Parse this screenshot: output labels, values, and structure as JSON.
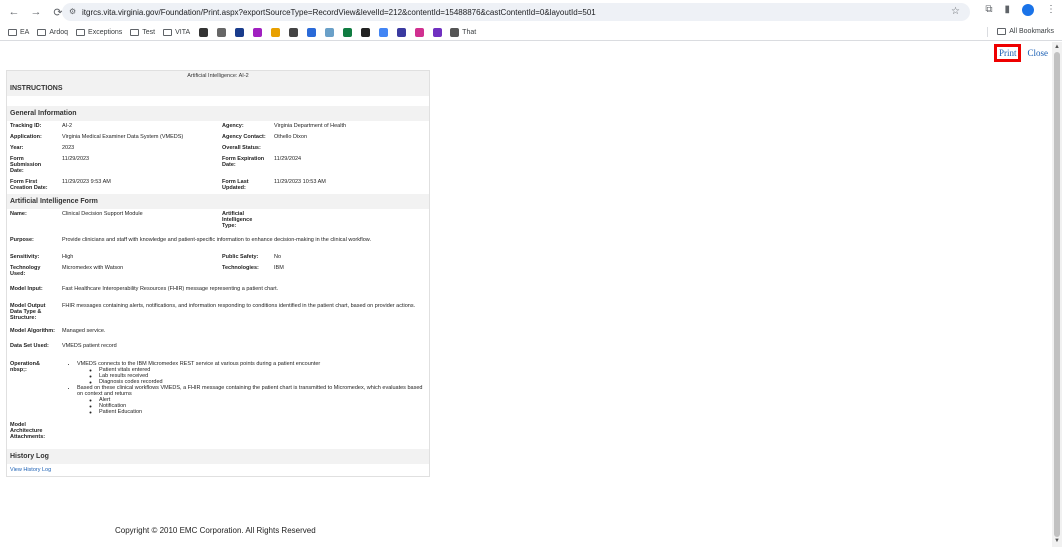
{
  "browser": {
    "url": "itgrcs.vita.virginia.gov/Foundation/Print.aspx?exportSourceType=RecordView&levelId=212&contentId=15488876&castContentId=0&layoutId=501",
    "bookmarks": [
      "EA",
      "Ardoq",
      "Exceptions",
      "Test",
      "VITA"
    ],
    "bookmark_last": "That",
    "all_bookmarks": "All Bookmarks"
  },
  "actions": {
    "print": "Print",
    "close": "Close"
  },
  "form": {
    "title": "Artificial Intelligence: AI-2",
    "instructions": "INSTRUCTIONS",
    "general_header": "General Information",
    "general": [
      {
        "l1": "Tracking ID:",
        "v1": "AI-2",
        "l2": "Agency:",
        "v2": "Virginia Department of Health"
      },
      {
        "l1": "Application:",
        "v1": "Virginia Medical Examiner Data System (VMEDS)",
        "l2": "Agency Contact:",
        "v2": "Othello Dixon"
      },
      {
        "l1": "Year:",
        "v1": "2023",
        "l2": "Overall Status:",
        "v2": ""
      },
      {
        "l1": "Form Submission Date:",
        "v1": "11/29/2023",
        "l2": "Form Expiration Date:",
        "v2": "11/29/2024"
      },
      {
        "l1": "Form First Creation Date:",
        "v1": "11/29/2023 9:53 AM",
        "l2": "Form Last Updated:",
        "v2": "11/29/2023 10:53 AM"
      }
    ],
    "ai_header": "Artificial Intelligence Form",
    "name_label": "Name:",
    "name_value": "Clinical Decision Support Module",
    "ai_type_label": "Artificial Intelligence Type:",
    "ai_type_value": "",
    "purpose_label": "Purpose:",
    "purpose_value": "Provide clinicians and staff with knowledge and patient-specific information to enhance decision-making in the clinical workflow.",
    "sensitivity_label": "Sensitivity:",
    "sensitivity_value": "High",
    "public_safety_label": "Public Safety:",
    "public_safety_value": "No",
    "tech_used_label": "Technology Used:",
    "tech_used_value": "Micromedex with Watson",
    "technologies_label": "Technologies:",
    "technologies_value": "IBM",
    "model_input_label": "Model Input:",
    "model_input_value": "Fast Healthcare Interoperability Resources (FHIR) message representing a patient chart.",
    "model_output_label": "Model Output Data Type & Structure:",
    "model_output_value": "FHIR messages containing alerts, notifications, and information responding to conditions identified in the patient chart, based on provider actions.",
    "algorithm_label": "Model Algorithm:",
    "algorithm_value": "Managed service.",
    "dataset_label": "Data Set Used:",
    "dataset_value": "VMEDS patient record",
    "operation_label": "Operation& nbsp;:",
    "op_1": "VMEDS connects to the IBM Micromedex REST service at various points during a patient encounter",
    "op_1_items": [
      "Patient vitals entered",
      "Lab results received",
      "Diagnosis codes recorded"
    ],
    "op_2": "Based on these clinical workflows VMEDS, a FHIR message containing the patient chart is transmitted to Micromedex, which evaluates based on context and returns",
    "op_2_items": [
      "Alert",
      "Notification",
      "Patient Education"
    ],
    "attachments_label": "Model Architecture Attachments:",
    "history_header": "History Log",
    "history_link": "View History Log"
  },
  "footer": {
    "copyright": "Copyright © 2010 EMC Corporation. All Rights Reserved"
  }
}
